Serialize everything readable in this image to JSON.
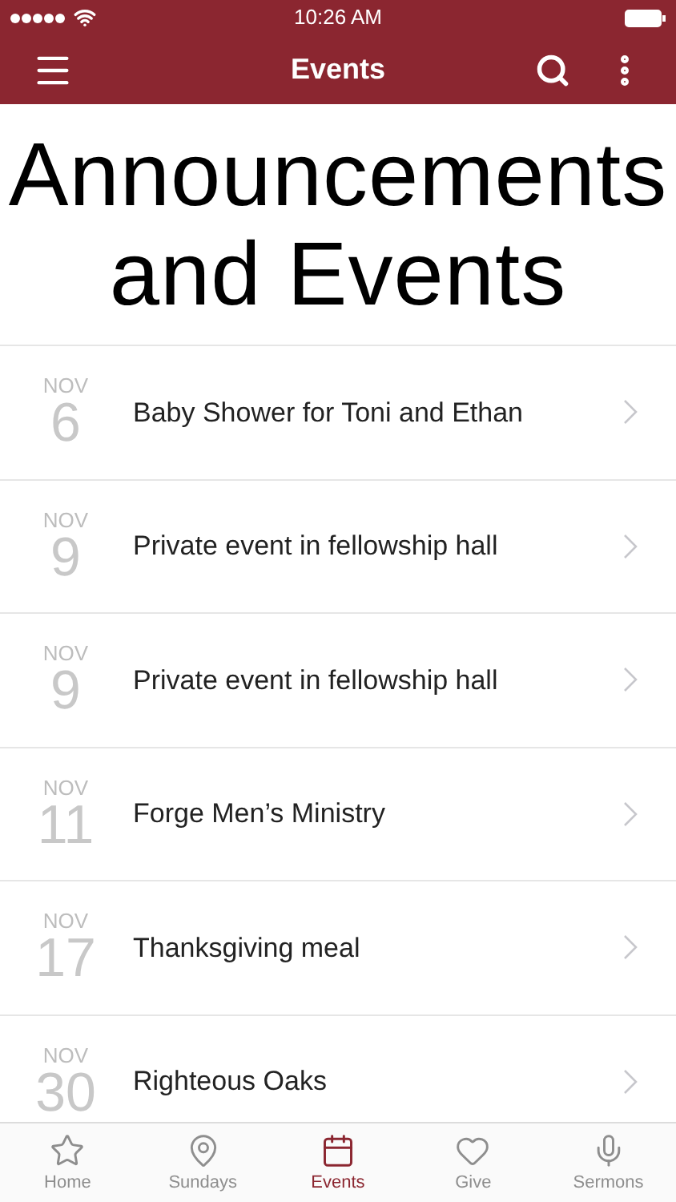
{
  "status_bar": {
    "time": "10:26 AM"
  },
  "nav_bar": {
    "title": "Events"
  },
  "heading": "Announcements and Events",
  "events": [
    {
      "month": "NOV",
      "day": "6",
      "title": "Baby Shower for Toni and Ethan"
    },
    {
      "month": "NOV",
      "day": "9",
      "title": "Private event in fellowship hall"
    },
    {
      "month": "NOV",
      "day": "9",
      "title": "Private event in fellowship hall"
    },
    {
      "month": "NOV",
      "day": "11",
      "title": "Forge Men’s Ministry"
    },
    {
      "month": "NOV",
      "day": "17",
      "title": "Thanksgiving meal"
    },
    {
      "month": "NOV",
      "day": "30",
      "title": "Righteous Oaks"
    }
  ],
  "tab_bar": [
    {
      "kind": "star",
      "label": "Home",
      "selected": false
    },
    {
      "kind": "pin",
      "label": "Sundays",
      "selected": false
    },
    {
      "kind": "calendar",
      "label": "Events",
      "selected": true
    },
    {
      "kind": "heart",
      "label": "Give",
      "selected": false
    },
    {
      "kind": "mic",
      "label": "Sermons",
      "selected": false
    }
  ]
}
